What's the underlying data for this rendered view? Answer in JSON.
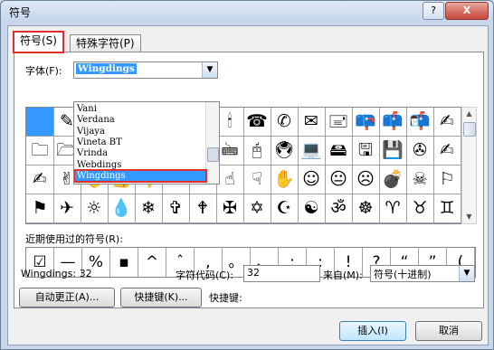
{
  "window": {
    "title": "符号",
    "help_label": "?",
    "close_label": "X"
  },
  "tabs": [
    {
      "label": "符号(S)"
    },
    {
      "label": "特殊字符(P)"
    }
  ],
  "font": {
    "label": "字体(F):",
    "value": "Wingdings"
  },
  "font_list": {
    "items": [
      "Vani",
      "Verdana",
      "Vijaya",
      "Vineta BT",
      "Vrinda",
      "Webdings",
      "Wingdings"
    ],
    "selected": "Wingdings"
  },
  "symbol_rows": [
    [
      "",
      "✎",
      "✂",
      "✁",
      "👓",
      "🕭",
      "🕮",
      "🕯",
      "☎",
      "✆",
      "✉",
      "🖃",
      "📪",
      "📫",
      "📬",
      "✍"
    ],
    [
      "🗀",
      "🗁",
      "🗋",
      "🗏",
      "🗐",
      "🗄",
      "⌛",
      "🖮",
      "🖰",
      "🖲",
      "💻",
      "🖴",
      "🖫",
      "💾",
      "✇",
      "✍"
    ],
    [
      "✍",
      "✌",
      "👌",
      "👍",
      "👎",
      "☜",
      "☞",
      "☝",
      "☟",
      "✋",
      "☺",
      "😐",
      "☹",
      "💣",
      "☠",
      "⚐"
    ],
    [
      "⚑",
      "✈",
      "☼",
      "💧",
      "❄",
      "✞",
      "🕈",
      "✠",
      "✡",
      "☪",
      "☯",
      "ॐ",
      "☸",
      "♈",
      "♉",
      "♊"
    ]
  ],
  "recent": {
    "label": "近期使用过的符号(R):",
    "symbols": [
      "☑",
      "—",
      "%",
      "▪",
      "^",
      "ˆ",
      ",",
      "。",
      "、",
      ";",
      ":",
      "!",
      "?",
      "“",
      "”",
      "("
    ]
  },
  "info": {
    "font_code": "Wingdings: 32",
    "char_code_label": "字符代码(C):",
    "char_code_value": "32",
    "from_label": "来自(M):",
    "from_value": "符号(十进制)"
  },
  "buttons": {
    "autocorrect": "自动更正(A)...",
    "shortcut": "快捷键(K)...",
    "shortcut_label": "快捷键:",
    "insert": "插入(I)",
    "cancel": "取消"
  }
}
